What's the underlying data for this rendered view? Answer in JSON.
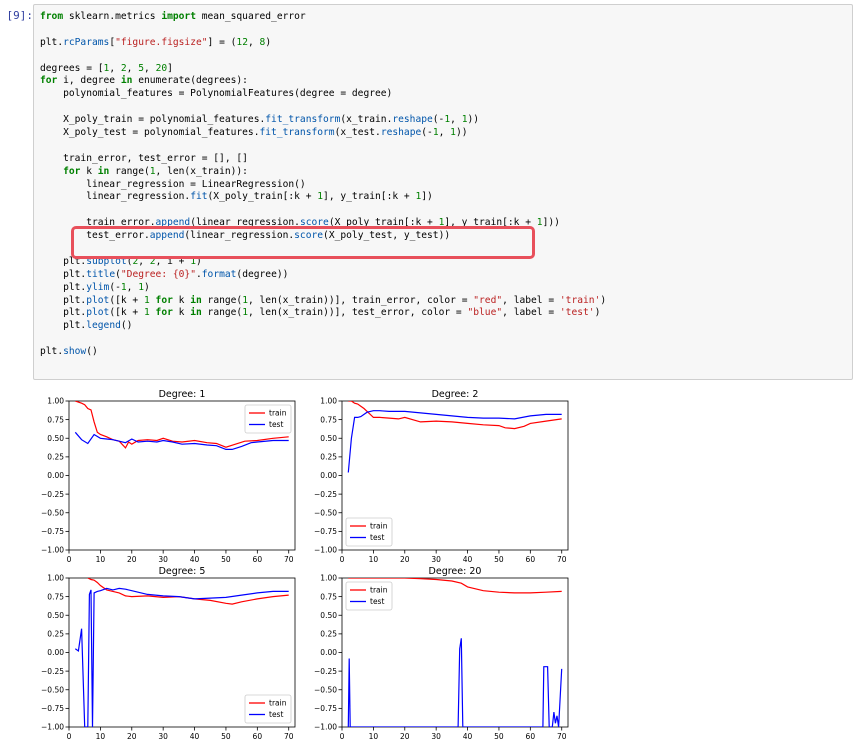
{
  "cell": {
    "prompt": "[9]:",
    "code_lines": [
      [
        [
          "kw",
          "from"
        ],
        [
          "t",
          " sklearn.metrics "
        ],
        [
          "kw",
          "import"
        ],
        [
          "t",
          " mean_squared_error"
        ]
      ],
      [],
      [
        [
          "t",
          "plt."
        ],
        [
          "fn",
          "rcParams"
        ],
        [
          "t",
          "["
        ],
        [
          "str",
          "\"figure.figsize\""
        ],
        [
          "t",
          "] = ("
        ],
        [
          "num",
          "12"
        ],
        [
          "t",
          ", "
        ],
        [
          "num",
          "8"
        ],
        [
          "t",
          ")"
        ]
      ],
      [],
      [
        [
          "t",
          "degrees = ["
        ],
        [
          "num",
          "1"
        ],
        [
          "t",
          ", "
        ],
        [
          "num",
          "2"
        ],
        [
          "t",
          ", "
        ],
        [
          "num",
          "5"
        ],
        [
          "t",
          ", "
        ],
        [
          "num",
          "20"
        ],
        [
          "t",
          "]"
        ]
      ],
      [
        [
          "kw",
          "for"
        ],
        [
          "t",
          " i, degree "
        ],
        [
          "kw",
          "in"
        ],
        [
          "t",
          " enumerate(degrees):"
        ]
      ],
      [
        [
          "t",
          "    polynomial_features = PolynomialFeatures(degree = degree)"
        ]
      ],
      [],
      [
        [
          "t",
          "    X_poly_train = polynomial_features."
        ],
        [
          "fn",
          "fit_transform"
        ],
        [
          "t",
          "(x_train."
        ],
        [
          "fn",
          "reshape"
        ],
        [
          "t",
          "(-"
        ],
        [
          "num",
          "1"
        ],
        [
          "t",
          ", "
        ],
        [
          "num",
          "1"
        ],
        [
          "t",
          "))"
        ]
      ],
      [
        [
          "t",
          "    X_poly_test = polynomial_features."
        ],
        [
          "fn",
          "fit_transform"
        ],
        [
          "t",
          "(x_test."
        ],
        [
          "fn",
          "reshape"
        ],
        [
          "t",
          "(-"
        ],
        [
          "num",
          "1"
        ],
        [
          "t",
          ", "
        ],
        [
          "num",
          "1"
        ],
        [
          "t",
          "))"
        ]
      ],
      [],
      [
        [
          "t",
          "    train_error, test_error = [], []"
        ]
      ],
      [
        [
          "kw",
          "    for"
        ],
        [
          "t",
          " k "
        ],
        [
          "kw",
          "in"
        ],
        [
          "t",
          " range("
        ],
        [
          "num",
          "1"
        ],
        [
          "t",
          ", len(x_train)):"
        ]
      ],
      [
        [
          "t",
          "        linear_regression = LinearRegression()"
        ]
      ],
      [
        [
          "t",
          "        linear_regression."
        ],
        [
          "fn",
          "fit"
        ],
        [
          "t",
          "(X_poly_train[:k + "
        ],
        [
          "num",
          "1"
        ],
        [
          "t",
          "], y_train[:k + "
        ],
        [
          "num",
          "1"
        ],
        [
          "t",
          "])"
        ]
      ],
      [],
      [
        [
          "t",
          "        train_error."
        ],
        [
          "fn",
          "append"
        ],
        [
          "t",
          "(linear_regression."
        ],
        [
          "fn",
          "score"
        ],
        [
          "t",
          "(X_poly_train[:k + "
        ],
        [
          "num",
          "1"
        ],
        [
          "t",
          "], y_train[:k + "
        ],
        [
          "num",
          "1"
        ],
        [
          "t",
          "]))"
        ]
      ],
      [
        [
          "t",
          "        test_error."
        ],
        [
          "fn",
          "append"
        ],
        [
          "t",
          "(linear_regression."
        ],
        [
          "fn",
          "score"
        ],
        [
          "t",
          "(X_poly_test, y_test))"
        ]
      ],
      [],
      [
        [
          "t",
          "    plt."
        ],
        [
          "fn",
          "subplot"
        ],
        [
          "t",
          "("
        ],
        [
          "num",
          "2"
        ],
        [
          "t",
          ", "
        ],
        [
          "num",
          "2"
        ],
        [
          "t",
          ", i + "
        ],
        [
          "num",
          "1"
        ],
        [
          "t",
          ")"
        ]
      ],
      [
        [
          "t",
          "    plt."
        ],
        [
          "fn",
          "title"
        ],
        [
          "t",
          "("
        ],
        [
          "str",
          "\"Degree: {0}\""
        ],
        [
          "t",
          "."
        ],
        [
          "fn",
          "format"
        ],
        [
          "t",
          "(degree))"
        ]
      ],
      [
        [
          "t",
          "    plt."
        ],
        [
          "fn",
          "ylim"
        ],
        [
          "t",
          "(-"
        ],
        [
          "num",
          "1"
        ],
        [
          "t",
          ", "
        ],
        [
          "num",
          "1"
        ],
        [
          "t",
          ")"
        ]
      ],
      [
        [
          "t",
          "    plt."
        ],
        [
          "fn",
          "plot"
        ],
        [
          "t",
          "([k + "
        ],
        [
          "num",
          "1"
        ],
        [
          "kw",
          " for"
        ],
        [
          "t",
          " k "
        ],
        [
          "kw",
          "in"
        ],
        [
          "t",
          " range("
        ],
        [
          "num",
          "1"
        ],
        [
          "t",
          ", len(x_train))], train_error, color = "
        ],
        [
          "str",
          "\"red\""
        ],
        [
          "t",
          ", label = "
        ],
        [
          "str",
          "'train'"
        ],
        [
          "t",
          ")"
        ]
      ],
      [
        [
          "t",
          "    plt."
        ],
        [
          "fn",
          "plot"
        ],
        [
          "t",
          "([k + "
        ],
        [
          "num",
          "1"
        ],
        [
          "kw",
          " for"
        ],
        [
          "t",
          " k "
        ],
        [
          "kw",
          "in"
        ],
        [
          "t",
          " range("
        ],
        [
          "num",
          "1"
        ],
        [
          "t",
          ", len(x_train))], test_error, color = "
        ],
        [
          "str",
          "\"blue\""
        ],
        [
          "t",
          ", label = "
        ],
        [
          "str",
          "'test'"
        ],
        [
          "t",
          ")"
        ]
      ],
      [
        [
          "t",
          "    plt."
        ],
        [
          "fn",
          "legend"
        ],
        [
          "t",
          "()"
        ]
      ],
      [],
      [
        [
          "t",
          "plt."
        ],
        [
          "fn",
          "show"
        ],
        [
          "t",
          "()"
        ]
      ]
    ]
  },
  "colors": {
    "train": "#ff0000",
    "test": "#0000ff",
    "highlight": "#e8505b"
  },
  "chart_data": [
    {
      "type": "line",
      "title": "Degree: 1",
      "xlim": [
        0,
        72
      ],
      "ylim": [
        -1.0,
        1.0
      ],
      "xticks": [
        0,
        10,
        20,
        30,
        40,
        50,
        60,
        70
      ],
      "yticks": [
        -1.0,
        -0.75,
        -0.5,
        -0.25,
        0.0,
        0.25,
        0.5,
        0.75,
        1.0
      ],
      "ytick_labels": [
        "−1.00",
        "−0.75",
        "−0.50",
        "−0.25",
        "0.00",
        "0.25",
        "0.50",
        "0.75",
        "1.00"
      ],
      "legend_loc": "upper right",
      "series": [
        {
          "name": "train",
          "color": "#ff0000",
          "x": [
            2,
            4,
            5,
            6,
            7,
            8,
            9,
            10,
            12,
            14,
            16,
            18,
            19,
            20,
            22,
            25,
            28,
            30,
            33,
            36,
            40,
            44,
            47,
            50,
            53,
            56,
            60,
            65,
            70
          ],
          "y": [
            1.0,
            0.97,
            0.95,
            0.9,
            0.88,
            0.72,
            0.58,
            0.55,
            0.52,
            0.48,
            0.46,
            0.37,
            0.45,
            0.42,
            0.47,
            0.48,
            0.47,
            0.5,
            0.46,
            0.45,
            0.47,
            0.44,
            0.43,
            0.38,
            0.42,
            0.46,
            0.47,
            0.5,
            0.52
          ]
        },
        {
          "name": "test",
          "color": "#0000ff",
          "x": [
            2,
            4,
            6,
            8,
            10,
            12,
            14,
            16,
            18,
            20,
            22,
            25,
            28,
            30,
            33,
            36,
            40,
            44,
            47,
            50,
            52,
            55,
            58,
            60,
            65,
            70
          ],
          "y": [
            0.58,
            0.48,
            0.43,
            0.55,
            0.5,
            0.49,
            0.48,
            0.46,
            0.44,
            0.49,
            0.45,
            0.46,
            0.45,
            0.47,
            0.45,
            0.42,
            0.43,
            0.41,
            0.4,
            0.35,
            0.35,
            0.39,
            0.44,
            0.45,
            0.47,
            0.47
          ]
        }
      ]
    },
    {
      "type": "line",
      "title": "Degree: 2",
      "xlim": [
        0,
        72
      ],
      "ylim": [
        -1.0,
        1.0
      ],
      "xticks": [
        0,
        10,
        20,
        30,
        40,
        50,
        60,
        70
      ],
      "yticks": [
        -1.0,
        -0.75,
        -0.5,
        -0.25,
        0.0,
        0.25,
        0.5,
        0.75,
        1.0
      ],
      "ytick_labels": [
        "−1.00",
        "−0.75",
        "−0.50",
        "−0.25",
        "0.00",
        "0.25",
        "0.50",
        "0.75",
        "1.00"
      ],
      "legend_loc": "lower left",
      "series": [
        {
          "name": "train",
          "color": "#ff0000",
          "x": [
            2,
            3,
            4,
            5,
            6,
            7,
            8,
            9,
            10,
            12,
            15,
            18,
            20,
            25,
            30,
            35,
            40,
            45,
            50,
            52,
            55,
            58,
            60,
            65,
            70
          ],
          "y": [
            1.0,
            1.0,
            0.97,
            0.96,
            0.93,
            0.9,
            0.86,
            0.82,
            0.78,
            0.78,
            0.77,
            0.76,
            0.78,
            0.72,
            0.73,
            0.72,
            0.7,
            0.68,
            0.67,
            0.64,
            0.63,
            0.66,
            0.7,
            0.73,
            0.76
          ]
        },
        {
          "name": "test",
          "color": "#0000ff",
          "x": [
            2,
            3,
            4,
            5,
            6,
            7,
            8,
            9,
            10,
            12,
            15,
            18,
            20,
            25,
            30,
            35,
            40,
            45,
            50,
            55,
            60,
            65,
            70
          ],
          "y": [
            0.04,
            0.5,
            0.78,
            0.78,
            0.79,
            0.82,
            0.85,
            0.86,
            0.87,
            0.87,
            0.86,
            0.86,
            0.86,
            0.84,
            0.82,
            0.8,
            0.78,
            0.77,
            0.77,
            0.76,
            0.8,
            0.82,
            0.82
          ]
        }
      ]
    },
    {
      "type": "line",
      "title": "Degree: 5",
      "xlim": [
        0,
        72
      ],
      "ylim": [
        -1.0,
        1.0
      ],
      "xticks": [
        0,
        10,
        20,
        30,
        40,
        50,
        60,
        70
      ],
      "yticks": [
        -1.0,
        -0.75,
        -0.5,
        -0.25,
        0.0,
        0.25,
        0.5,
        0.75,
        1.0
      ],
      "ytick_labels": [
        "−1.00",
        "−0.75",
        "−0.50",
        "−0.25",
        "0.00",
        "0.25",
        "0.50",
        "0.75",
        "1.00"
      ],
      "legend_loc": "lower right",
      "series": [
        {
          "name": "train",
          "color": "#ff0000",
          "x": [
            6,
            7,
            8,
            9,
            10,
            12,
            14,
            16,
            18,
            20,
            25,
            30,
            35,
            40,
            45,
            50,
            52,
            55,
            60,
            65,
            70
          ],
          "y": [
            1.0,
            0.98,
            0.97,
            0.94,
            0.9,
            0.84,
            0.82,
            0.8,
            0.76,
            0.75,
            0.76,
            0.74,
            0.75,
            0.72,
            0.7,
            0.66,
            0.65,
            0.68,
            0.72,
            0.75,
            0.77
          ]
        },
        {
          "name": "test",
          "color": "#0000ff",
          "x": [
            2,
            3,
            4,
            5,
            6,
            6.5,
            7,
            7.5,
            8,
            9,
            10,
            12,
            14,
            16,
            18,
            20,
            25,
            30,
            35,
            40,
            45,
            50,
            55,
            60,
            65,
            70
          ],
          "y": [
            0.05,
            0.02,
            0.32,
            -1.0,
            -1.0,
            0.78,
            0.84,
            -1.0,
            0.8,
            0.82,
            0.83,
            0.86,
            0.84,
            0.86,
            0.85,
            0.83,
            0.78,
            0.76,
            0.75,
            0.72,
            0.73,
            0.74,
            0.77,
            0.8,
            0.82,
            0.82
          ]
        }
      ]
    },
    {
      "type": "line",
      "title": "Degree: 20",
      "xlim": [
        0,
        72
      ],
      "ylim": [
        -1.0,
        1.0
      ],
      "xticks": [
        0,
        10,
        20,
        30,
        40,
        50,
        60,
        70
      ],
      "yticks": [
        -1.0,
        -0.75,
        -0.5,
        -0.25,
        0.0,
        0.25,
        0.5,
        0.75,
        1.0
      ],
      "ytick_labels": [
        "−1.00",
        "−0.75",
        "−0.50",
        "−0.25",
        "0.00",
        "0.25",
        "0.50",
        "0.75",
        "1.00"
      ],
      "legend_loc": "upper left",
      "series": [
        {
          "name": "train",
          "color": "#ff0000",
          "x": [
            2,
            10,
            20,
            25,
            30,
            35,
            38,
            40,
            45,
            50,
            55,
            60,
            65,
            70
          ],
          "y": [
            1.0,
            1.0,
            1.0,
            0.99,
            0.98,
            0.96,
            0.93,
            0.88,
            0.83,
            0.81,
            0.8,
            0.8,
            0.81,
            0.82
          ]
        },
        {
          "name": "test",
          "color": "#0000ff",
          "x": [
            2,
            2.3,
            2.6,
            37,
            37.5,
            38,
            38.5,
            64,
            64.3,
            65.5,
            66,
            67,
            67.5,
            68,
            68.5,
            69,
            70
          ],
          "y": [
            -1.0,
            -0.08,
            -1.0,
            -1.0,
            0.05,
            0.19,
            -1.0,
            -1.0,
            -0.19,
            -0.19,
            -1.0,
            -1.0,
            -0.8,
            -0.95,
            -0.85,
            -1.0,
            -0.22
          ]
        }
      ]
    }
  ]
}
